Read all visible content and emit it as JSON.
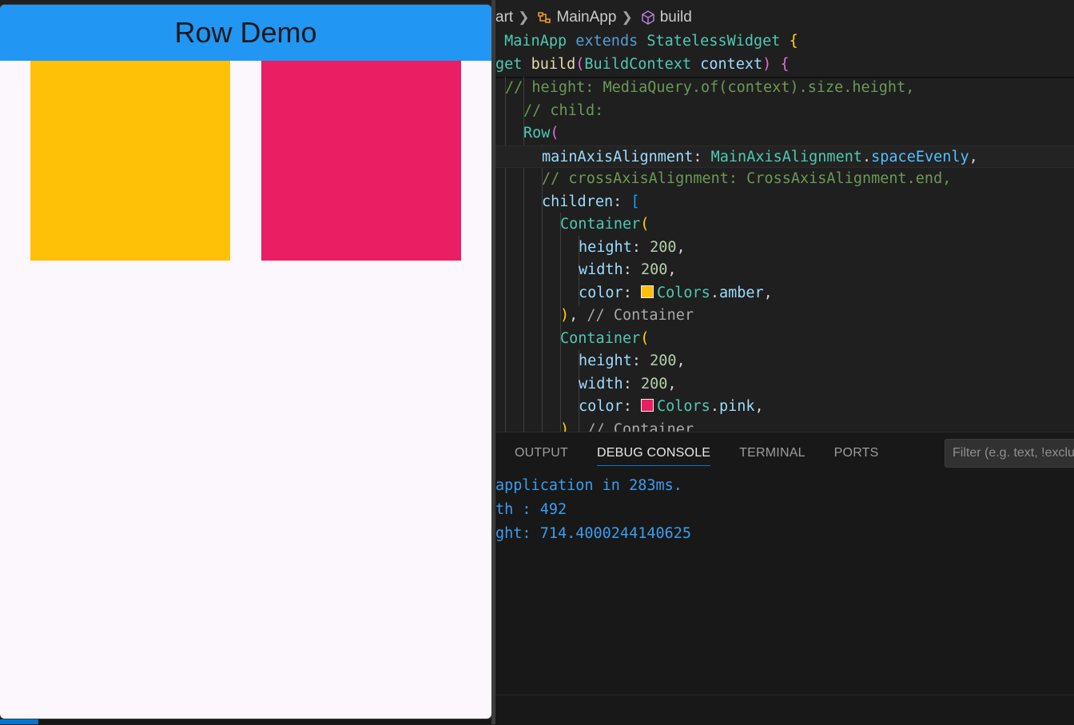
{
  "app": {
    "title": "Row Demo",
    "containers": [
      {
        "name": "amber",
        "color": "#ffc107",
        "size": 200
      },
      {
        "name": "pink",
        "color": "#e91e63",
        "size": 200
      }
    ],
    "background": "#fcf7fd",
    "appbar_color": "#2196f3"
  },
  "breadcrumb": {
    "file": "art",
    "class_name": "MainApp",
    "method": "build",
    "class_icon": "class-symbol-icon",
    "method_icon": "method-cube-icon"
  },
  "sticky_lines": [
    [
      {
        "t": " MainApp ",
        "c": "t-cls"
      },
      {
        "t": "extends ",
        "c": "t-kw"
      },
      {
        "t": "StatelessWidget ",
        "c": "t-cls"
      },
      {
        "t": "{",
        "c": "t-br1"
      }
    ],
    [
      {
        "t": "get ",
        "c": "t-cls"
      },
      {
        "t": "build",
        "c": "t-fn"
      },
      {
        "t": "(",
        "c": "t-br2"
      },
      {
        "t": "BuildContext ",
        "c": "t-cls"
      },
      {
        "t": "context",
        "c": "t-prop"
      },
      {
        "t": ") ",
        "c": "t-br2"
      },
      {
        "t": "{",
        "c": "t-br2"
      }
    ]
  ],
  "code_lines": [
    {
      "indent": 1,
      "tokens": [
        {
          "t": "// height: MediaQuery.of(context).size.height,",
          "c": "t-com"
        }
      ]
    },
    {
      "indent": 2,
      "tokens": [
        {
          "t": "// child:",
          "c": "t-com"
        }
      ]
    },
    {
      "indent": 2,
      "tokens": [
        {
          "t": "Row",
          "c": "t-cls"
        },
        {
          "t": "(",
          "c": "t-br2"
        }
      ]
    },
    {
      "indent": 3,
      "current": true,
      "tokens": [
        {
          "t": "mainAxisAlignment",
          "c": "t-prop"
        },
        {
          "t": ": ",
          "c": "t-white"
        },
        {
          "t": "MainAxisAlignment",
          "c": "t-cls"
        },
        {
          "t": ".",
          "c": "t-white"
        },
        {
          "t": "spaceEvenly",
          "c": "t-cls2"
        },
        {
          "t": ",",
          "c": "t-white"
        }
      ]
    },
    {
      "indent": 3,
      "tokens": [
        {
          "t": "// crossAxisAlignment: CrossAxisAlignment.end,",
          "c": "t-com"
        }
      ]
    },
    {
      "indent": 3,
      "tokens": [
        {
          "t": "children",
          "c": "t-prop"
        },
        {
          "t": ": ",
          "c": "t-white"
        },
        {
          "t": "[",
          "c": "t-br3"
        }
      ]
    },
    {
      "indent": 4,
      "tokens": [
        {
          "t": "Container",
          "c": "t-cls"
        },
        {
          "t": "(",
          "c": "t-br1"
        }
      ]
    },
    {
      "indent": 5,
      "tokens": [
        {
          "t": "height",
          "c": "t-prop"
        },
        {
          "t": ": ",
          "c": "t-white"
        },
        {
          "t": "200",
          "c": "t-num"
        },
        {
          "t": ",",
          "c": "t-white"
        }
      ]
    },
    {
      "indent": 5,
      "tokens": [
        {
          "t": "width",
          "c": "t-prop"
        },
        {
          "t": ": ",
          "c": "t-white"
        },
        {
          "t": "200",
          "c": "t-num"
        },
        {
          "t": ",",
          "c": "t-white"
        }
      ]
    },
    {
      "indent": 5,
      "tokens": [
        {
          "t": "color",
          "c": "t-prop"
        },
        {
          "t": ": ",
          "c": "t-white"
        },
        {
          "swatch": "#ffc107"
        },
        {
          "t": "Colors",
          "c": "t-cls"
        },
        {
          "t": ".",
          "c": "t-white"
        },
        {
          "t": "amber",
          "c": "t-prop"
        },
        {
          "t": ",",
          "c": "t-white"
        }
      ]
    },
    {
      "indent": 4,
      "tokens": [
        {
          "t": ")",
          "c": "t-br1"
        },
        {
          "t": ", ",
          "c": "t-white"
        },
        {
          "t": "// Container",
          "c": "t-gray"
        }
      ]
    },
    {
      "indent": 4,
      "tokens": [
        {
          "t": "Container",
          "c": "t-cls"
        },
        {
          "t": "(",
          "c": "t-br1"
        }
      ]
    },
    {
      "indent": 5,
      "tokens": [
        {
          "t": "height",
          "c": "t-prop"
        },
        {
          "t": ": ",
          "c": "t-white"
        },
        {
          "t": "200",
          "c": "t-num"
        },
        {
          "t": ",",
          "c": "t-white"
        }
      ]
    },
    {
      "indent": 5,
      "tokens": [
        {
          "t": "width",
          "c": "t-prop"
        },
        {
          "t": ": ",
          "c": "t-white"
        },
        {
          "t": "200",
          "c": "t-num"
        },
        {
          "t": ",",
          "c": "t-white"
        }
      ]
    },
    {
      "indent": 5,
      "tokens": [
        {
          "t": "color",
          "c": "t-prop"
        },
        {
          "t": ": ",
          "c": "t-white"
        },
        {
          "swatch": "#e91e63"
        },
        {
          "t": "Colors",
          "c": "t-cls"
        },
        {
          "t": ".",
          "c": "t-white"
        },
        {
          "t": "pink",
          "c": "t-prop"
        },
        {
          "t": ",",
          "c": "t-white"
        }
      ]
    },
    {
      "indent": 4,
      "tokens": [
        {
          "t": ")",
          "c": "t-br1"
        },
        {
          "t": ", ",
          "c": "t-white"
        },
        {
          "t": "// Container",
          "c": "t-gray"
        }
      ]
    }
  ],
  "panel": {
    "tabs": [
      {
        "label": "OUTPUT",
        "active": false
      },
      {
        "label": "DEBUG CONSOLE",
        "active": true
      },
      {
        "label": "TERMINAL",
        "active": false
      },
      {
        "label": "PORTS",
        "active": false
      }
    ],
    "filter_placeholder": "Filter (e.g. text, !exclude)",
    "console_lines": [
      "application in 283ms.",
      "th : 492",
      "ght: 714.4000244140625"
    ]
  }
}
